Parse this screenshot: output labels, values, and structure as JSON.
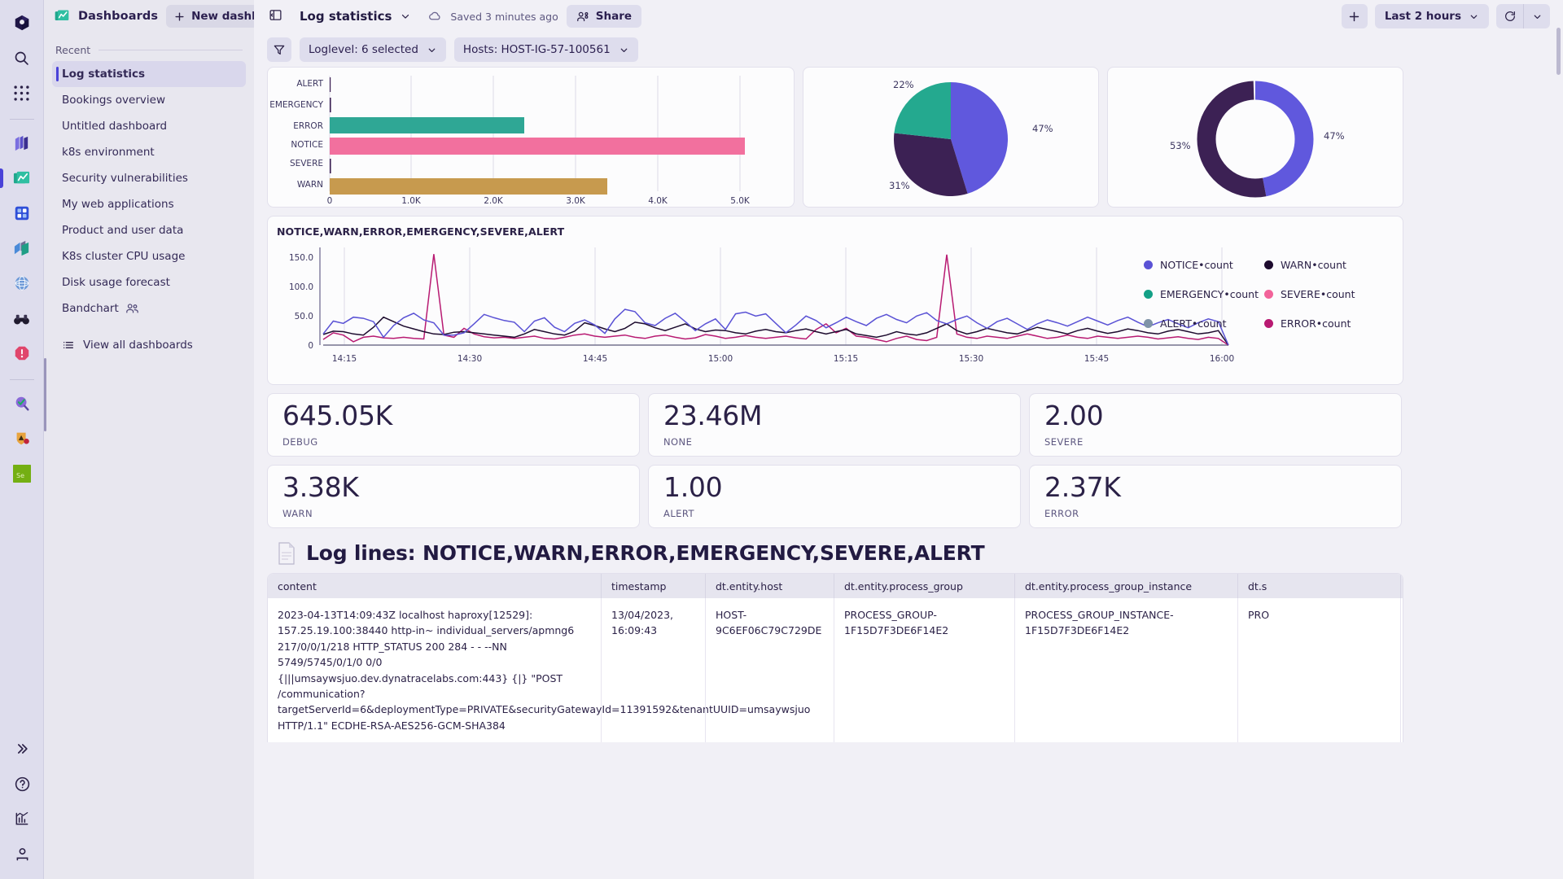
{
  "rail": {
    "logo": "cube-logo",
    "icons": [
      {
        "name": "search-icon"
      },
      {
        "name": "grid-apps-icon"
      },
      {
        "name": "layers-icon"
      },
      {
        "name": "dashboards-icon"
      },
      {
        "name": "notebooks-icon"
      },
      {
        "name": "data-explorer-icon"
      },
      {
        "name": "globe-icon"
      },
      {
        "name": "binoculars-icon"
      },
      {
        "name": "problems-icon"
      },
      {
        "name": "davis-copilot-icon"
      },
      {
        "name": "security-icon"
      },
      {
        "name": "se-tile-icon"
      }
    ],
    "bottom": [
      {
        "name": "expand-rail-icon",
        "glyph": "»"
      },
      {
        "name": "help-icon",
        "glyph": "?"
      },
      {
        "name": "reports-icon",
        "glyph": "chart"
      },
      {
        "name": "user-account-icon",
        "glyph": "person"
      }
    ]
  },
  "sidebar": {
    "brand_title": "Dashboards",
    "new_dashboard_label": "New dashboard",
    "upload_icon": "upload-icon",
    "recent_label": "Recent",
    "items": [
      {
        "label": "Log statistics",
        "active": true
      },
      {
        "label": "Bookings overview",
        "active": false
      },
      {
        "label": "Untitled dashboard",
        "active": false
      },
      {
        "label": "k8s environment",
        "active": false
      },
      {
        "label": "Security vulnerabilities",
        "active": false
      },
      {
        "label": "My web applications",
        "active": false
      },
      {
        "label": "Product and user data",
        "active": false
      },
      {
        "label": "K8s cluster CPU usage",
        "active": false
      },
      {
        "label": "Disk usage forecast",
        "active": false
      },
      {
        "label": "Bandchart",
        "active": false,
        "shared": true
      }
    ],
    "view_all_label": "View all dashboards"
  },
  "topbar": {
    "collapse_icon": "panel-collapse-icon",
    "dashboard_name": "Log statistics",
    "saved_text": "Saved 3 minutes ago",
    "share_label": "Share",
    "add_label": "+",
    "timeframe_label": "Last 2 hours",
    "refresh_icon": "refresh-icon",
    "refresh_menu_icon": "chevron-down-icon",
    "help_icon": "help-circle-icon"
  },
  "filters": {
    "filter_icon": "filter-icon",
    "chips": [
      {
        "label": "Loglevel: 6 selected"
      },
      {
        "label": "Hosts: HOST-IG-57-100561"
      }
    ]
  },
  "kpis": [
    {
      "value": "645.05K",
      "label": "DEBUG"
    },
    {
      "value": "23.46M",
      "label": "NONE"
    },
    {
      "value": "2.00",
      "label": "SEVERE"
    },
    {
      "value": "3.38K",
      "label": "WARN"
    },
    {
      "value": "1.00",
      "label": "ALERT"
    },
    {
      "value": "2.37K",
      "label": "ERROR"
    }
  ],
  "loglines": {
    "icon": "log-file-icon",
    "title": "Log lines: NOTICE,WARN,ERROR,EMERGENCY,SEVERE,ALERT",
    "columns": [
      "content",
      "timestamp",
      "dt.entity.host",
      "dt.entity.process_group",
      "dt.entity.process_group_instance",
      "dt.s"
    ],
    "rows": [
      {
        "content": "2023-04-13T14:09:43Z localhost haproxy[12529]: 157.25.19.100:38440 http-in~ individual_servers/apmng6 217/0/0/1/218 HTTP_STATUS 200 284 - - --NN 5749/5745/0/1/0 0/0 {|||umsaywsjuo.dev.dynatracelabs.com:443} {|} \"POST /communication?targetServerId=6&deploymentType=PRIVATE&securityGatewayId=11391592&tenantUUID=umsaywsjuo HTTP/1.1\" ECDHE-RSA-AES256-GCM-SHA384",
        "timestamp": "13/04/2023, 16:09:43",
        "host": "HOST-9C6EF06C79C729DE",
        "process_group": "PROCESS_GROUP-1F15D7F3DE6F14E2",
        "process_group_instance": "PROCESS_GROUP_INSTANCE-1F15D7F3DE6F14E2",
        "last": "PRO"
      }
    ]
  },
  "colors": {
    "notice": "#5a52d5",
    "warn": "#1d0b2e",
    "emergency": "#13a086",
    "severe": "#f2639a",
    "alert": "#7f93a8",
    "error": "#b81a72",
    "bar_error": "#2fa795",
    "bar_notice": "#f2709e",
    "bar_warn": "#c79a4e",
    "pie_blue": "#6058dd",
    "pie_dark": "#3c2154",
    "pie_teal": "#24a98f"
  },
  "chart_data": [
    {
      "type": "bar",
      "orientation": "horizontal",
      "title": "",
      "categories": [
        "ALERT",
        "EMERGENCY",
        "ERROR",
        "NOTICE",
        "SEVERE",
        "WARN"
      ],
      "values": [
        1,
        1,
        2370,
        5050,
        2,
        3380
      ],
      "bar_colors": [
        "#3c2154",
        "#3c2154",
        "#2fa795",
        "#f2709e",
        "#3c2154",
        "#c79a4e"
      ],
      "xlabel": "",
      "ylabel": "",
      "xlim": [
        0,
        5400
      ],
      "xticks": [
        0,
        1000,
        2000,
        3000,
        4000,
        5000
      ],
      "xticklabels": [
        "0",
        "1.0K",
        "2.0K",
        "3.0K",
        "4.0K",
        "5.0K"
      ],
      "grid": true
    },
    {
      "type": "pie",
      "title": "",
      "labels": [
        "47%",
        "31%",
        "22%"
      ],
      "values": [
        47,
        31,
        22
      ],
      "slice_colors": [
        "#6058dd",
        "#3c2154",
        "#24a98f"
      ],
      "legend": "none"
    },
    {
      "type": "pie",
      "variant": "donut",
      "title": "",
      "labels": [
        "47%",
        "53%"
      ],
      "values": [
        47,
        53
      ],
      "slice_colors": [
        "#6058dd",
        "#3c2154"
      ],
      "legend": "none"
    },
    {
      "type": "line",
      "title": "NOTICE,WARN,ERROR,EMERGENCY,SEVERE,ALERT",
      "xlabel": "",
      "ylabel": "",
      "ylim": [
        0,
        175
      ],
      "yticks": [
        0,
        50,
        100,
        150
      ],
      "yticklabels": [
        "0",
        "50.0",
        "100.0",
        "150.0"
      ],
      "xticklabels": [
        "14:15",
        "14:30",
        "14:45",
        "15:00",
        "15:15",
        "15:30",
        "15:45",
        "16:00"
      ],
      "grid": true,
      "legend": "right",
      "series": [
        {
          "name": "NOTICE•count",
          "color": "#5a52d5",
          "values": [
            20,
            43,
            39,
            50,
            48,
            42,
            14,
            35,
            49,
            57,
            45,
            40,
            18,
            18,
            22,
            38,
            55,
            49,
            44,
            41,
            24,
            43,
            49,
            32,
            24,
            39,
            45,
            36,
            21,
            47,
            64,
            60,
            40,
            35,
            48,
            57,
            42,
            26,
            38,
            47,
            28,
            56,
            59,
            52,
            56,
            39,
            22,
            36,
            52,
            44,
            31,
            40,
            50,
            42,
            35,
            48,
            55,
            46,
            40,
            52,
            58,
            44,
            38,
            46,
            52,
            40,
            30,
            42,
            48,
            38,
            28,
            38,
            45,
            40,
            34,
            42,
            50,
            43,
            36,
            44,
            50,
            41,
            33,
            40,
            46,
            38,
            31,
            40,
            47,
            42,
            0
          ]
        },
        {
          "name": "WARN•count",
          "color": "#1d0b2e",
          "values": [
            19,
            25,
            24,
            20,
            18,
            32,
            50,
            42,
            34,
            29,
            24,
            20,
            19,
            23,
            24,
            22,
            20,
            18,
            16,
            14,
            20,
            28,
            24,
            20,
            18,
            25,
            40,
            35,
            29,
            24,
            30,
            41,
            38,
            31,
            26,
            32,
            38,
            29,
            24,
            27,
            26,
            22,
            20,
            25,
            28,
            24,
            22,
            26,
            29,
            24,
            20,
            24,
            28,
            20,
            17,
            14,
            18,
            24,
            20,
            18,
            22,
            30,
            38,
            26,
            20,
            24,
            30,
            26,
            22,
            20,
            26,
            32,
            28,
            24,
            20,
            26,
            30,
            25,
            21,
            24,
            29,
            26,
            22,
            20,
            25,
            28,
            24,
            20,
            22,
            26,
            0
          ]
        },
        {
          "name": "EMERGENCY•count",
          "color": "#13a086",
          "values": [
            0
          ]
        },
        {
          "name": "SEVERE•count",
          "color": "#f2639a",
          "values": [
            0
          ]
        },
        {
          "name": "ALERT•count",
          "color": "#7f93a8",
          "values": [
            0
          ]
        },
        {
          "name": "ERROR•count",
          "color": "#b81a72",
          "values": [
            10,
            22,
            18,
            6,
            14,
            16,
            13,
            12,
            14,
            12,
            11,
            163,
            18,
            14,
            30,
            20,
            15,
            13,
            14,
            12,
            14,
            16,
            12,
            11,
            14,
            18,
            20,
            16,
            14,
            16,
            18,
            14,
            12,
            16,
            18,
            14,
            11,
            13,
            19,
            16,
            12,
            14,
            17,
            14,
            12,
            14,
            16,
            13,
            11,
            28,
            38,
            22,
            30,
            16,
            14,
            10,
            6,
            12,
            16,
            10,
            8,
            14,
            162,
            20,
            14,
            12,
            16,
            14,
            12,
            16,
            20,
            16,
            12,
            14,
            18,
            14,
            12,
            16,
            14,
            12,
            14,
            16,
            14,
            11,
            13,
            15,
            12,
            10,
            14,
            12,
            0
          ]
        }
      ]
    }
  ]
}
